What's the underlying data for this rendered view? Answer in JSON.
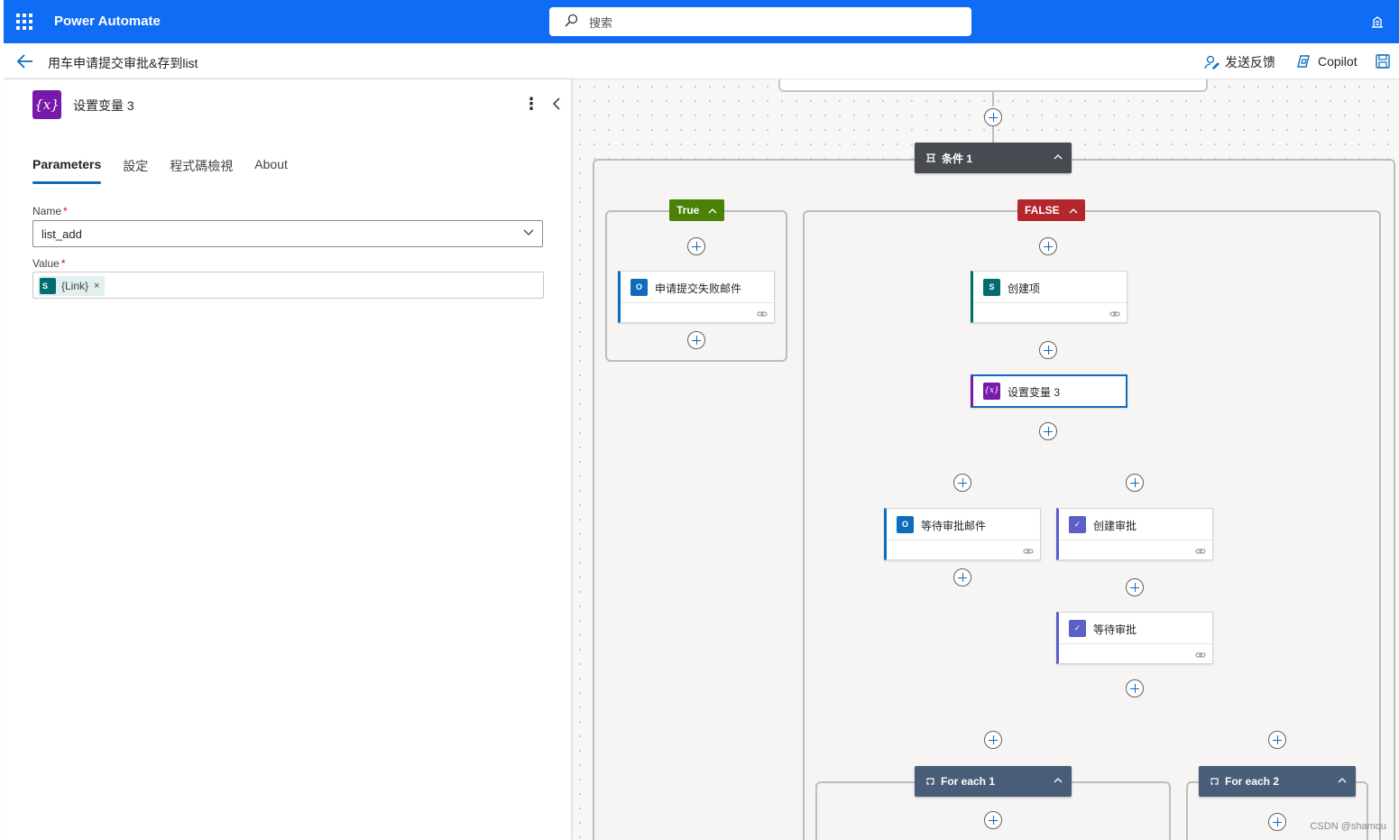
{
  "app": {
    "name": "Power Automate"
  },
  "search": {
    "placeholder": "搜索"
  },
  "subbar": {
    "flow_title": "用车申请提交审批&存到list",
    "feedback_label": "发送反馈",
    "copilot_label": "Copilot"
  },
  "panel": {
    "icon_text": "{x}",
    "title": "设置变量 3",
    "more_label": "⋮",
    "tabs": [
      {
        "label": "Parameters",
        "active": true
      },
      {
        "label": "設定",
        "active": false
      },
      {
        "label": "程式碼檢視",
        "active": false
      },
      {
        "label": "About",
        "active": false
      }
    ],
    "fields": {
      "name": {
        "label": "Name",
        "required": "*",
        "value": "list_add"
      },
      "value": {
        "label": "Value",
        "required": "*",
        "token_label": "{Link}",
        "token_remove": "×",
        "token_icon": "S"
      }
    }
  },
  "canvas": {
    "condition": {
      "label": "条件 1"
    },
    "true_branch": {
      "label": "True"
    },
    "false_branch": {
      "label": "FALSE"
    },
    "cards": [
      {
        "title": "申请提交失败邮件",
        "icon": "outlook-icon"
      },
      {
        "title": "创建项",
        "icon": "sharepoint-icon"
      },
      {
        "title": "设置变量 3",
        "icon": "variable-icon",
        "selected": true
      },
      {
        "title": "等待审批邮件",
        "icon": "outlook-icon"
      },
      {
        "title": "创建审批",
        "icon": "approvals-icon"
      },
      {
        "title": "等待审批",
        "icon": "approvals-icon"
      }
    ],
    "loops": [
      {
        "label": "For each 1"
      },
      {
        "label": "For each 2"
      }
    ]
  },
  "watermark": "CSDN @shamqu",
  "colors": {
    "topbar": "#0f6cf5",
    "true_badge": "#498205",
    "false_badge": "#b3262d",
    "variable": "#7719aa",
    "sharepoint": "#036c70",
    "approvals": "#5b5fc7",
    "loop_header": "#485d78",
    "condition_header": "#474a50"
  }
}
